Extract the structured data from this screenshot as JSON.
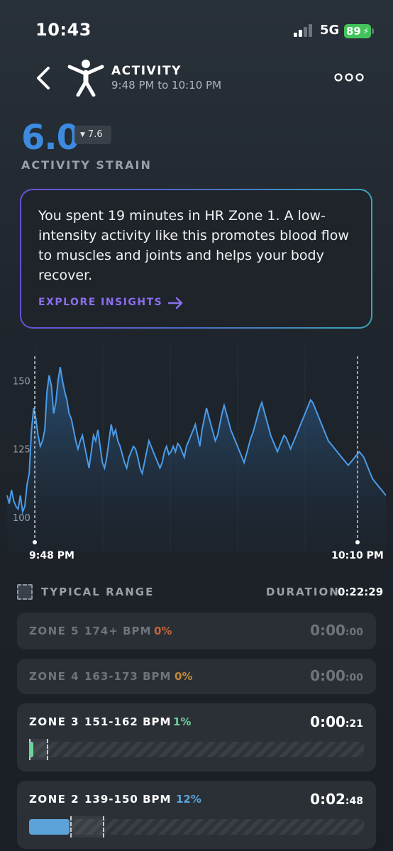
{
  "status": {
    "time": "10:43",
    "network": "5G",
    "battery": "89"
  },
  "header": {
    "title": "ACTIVITY",
    "time_range": "9:48 PM to 10:10 PM"
  },
  "strain": {
    "value": "6.0",
    "badge": "7.6",
    "label": "ACTIVITY STRAIN"
  },
  "insight": {
    "text": "You spent 19 minutes in HR Zone 1. A low-intensity activity like this promotes blood flow to muscles and joints and helps your body recover.",
    "link": "EXPLORE INSIGHTS"
  },
  "chart_data": {
    "type": "area",
    "y_ticks": [
      "150",
      "125",
      "100"
    ],
    "ylim": [
      95,
      160
    ],
    "x_labels": [
      "9:48 PM",
      "10:10 PM"
    ],
    "y_values": [
      108,
      105,
      110,
      106,
      104,
      103,
      108,
      102,
      104,
      112,
      116,
      132,
      140,
      136,
      130,
      126,
      128,
      132,
      146,
      152,
      148,
      138,
      142,
      150,
      155,
      150,
      146,
      143,
      138,
      136,
      132,
      128,
      125,
      128,
      130,
      126,
      122,
      118,
      124,
      130,
      128,
      132,
      126,
      120,
      118,
      122,
      128,
      134,
      130,
      132,
      128,
      126,
      123,
      120,
      118,
      122,
      124,
      126,
      125,
      122,
      118,
      116,
      120,
      124,
      128,
      126,
      124,
      122,
      120,
      118,
      120,
      124,
      126,
      123,
      124,
      126,
      124,
      127,
      126,
      124,
      122,
      126,
      128,
      130,
      132,
      134,
      130,
      126,
      132,
      136,
      140,
      137,
      134,
      131,
      128,
      130,
      134,
      138,
      141,
      138,
      135,
      132,
      130,
      128,
      126,
      124,
      122,
      120,
      123,
      126,
      129,
      131,
      134,
      137,
      140,
      142,
      139,
      136,
      133,
      130,
      128,
      126,
      124,
      126,
      128,
      130,
      129,
      127,
      125,
      127,
      129,
      131,
      133,
      135,
      137,
      139,
      141,
      143,
      142,
      140,
      138,
      136,
      134,
      132,
      130,
      128,
      127,
      126,
      125,
      124,
      123,
      122,
      121,
      120,
      119,
      120,
      121,
      122,
      123,
      124,
      123,
      122,
      120,
      118,
      116,
      114,
      113,
      112,
      111,
      110,
      109,
      108
    ],
    "series_color": "#4a9be8"
  },
  "legend": {
    "typical_range": "TYPICAL RANGE",
    "duration_label": "DURATION",
    "duration_value": "0:22:29"
  },
  "zones": [
    {
      "name": "ZONE 5",
      "bpm": "174+ BPM",
      "pct": "0%",
      "time_main": "0:00",
      "time_sec": ":00",
      "pct_color": "#c0663a",
      "fill": 0
    },
    {
      "name": "ZONE 4",
      "bpm": "163-173 BPM",
      "pct": "0%",
      "time_main": "0:00",
      "time_sec": ":00",
      "pct_color": "#c08a3a",
      "fill": 0
    },
    {
      "name": "ZONE 3",
      "bpm": "151-162 BPM",
      "pct": "1%",
      "time_main": "0:00",
      "time_sec": ":21",
      "pct_color": "#6ed39a",
      "fill": 0.01
    },
    {
      "name": "ZONE 2",
      "bpm": "139-150 BPM",
      "pct": "12%",
      "time_main": "0:02",
      "time_sec": ":48",
      "pct_color": "#5ba3d9",
      "fill": 0.12
    }
  ]
}
